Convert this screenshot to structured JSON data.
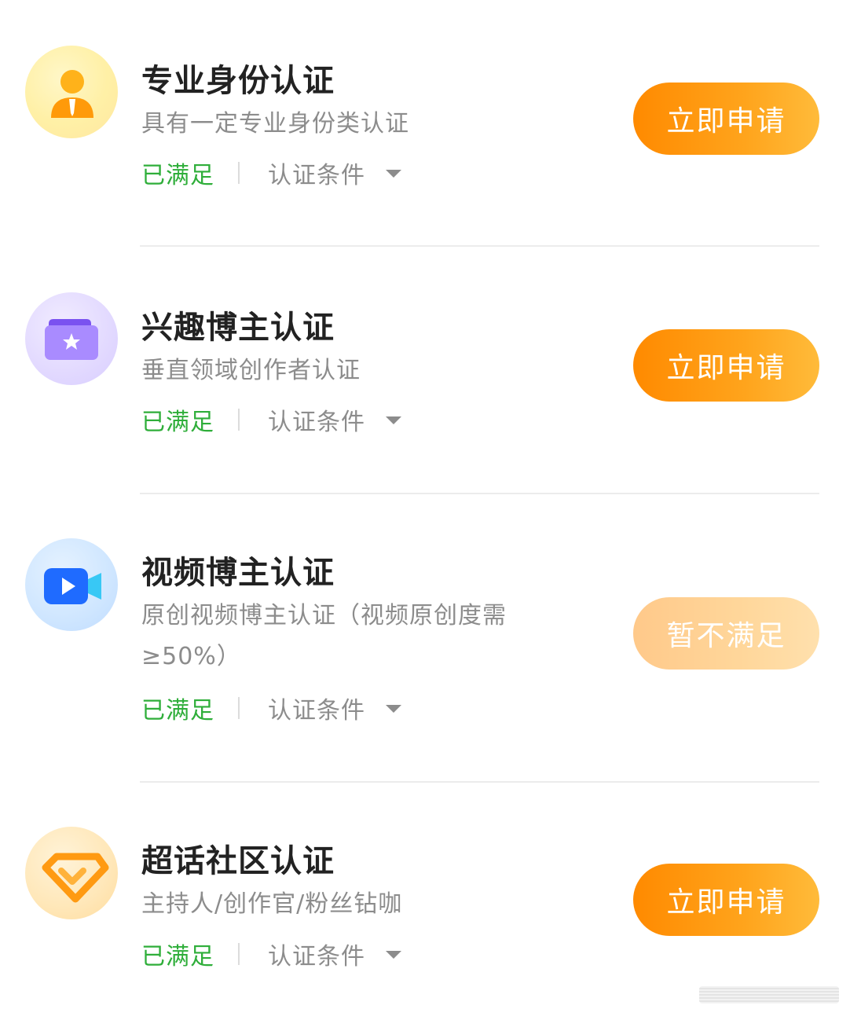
{
  "items": [
    {
      "title": "专业身份认证",
      "desc": "具有一定专业身份类认证",
      "status": "已满足",
      "conditions": "认证条件",
      "button": "立即申请",
      "icon": "person-badge-icon"
    },
    {
      "title": "兴趣博主认证",
      "desc": "垂直领域创作者认证",
      "status": "已满足",
      "conditions": "认证条件",
      "button": "立即申请",
      "icon": "folder-star-icon"
    },
    {
      "title": "视频博主认证",
      "desc": "原创视频博主认证（视频原创度需≥50%）",
      "status": "已满足",
      "conditions": "认证条件",
      "button": "暂不满足",
      "icon": "video-camera-icon"
    },
    {
      "title": "超话社区认证",
      "desc": "主持人/创作官/粉丝钻咖",
      "status": "已满足",
      "conditions": "认证条件",
      "button": "立即申请",
      "icon": "diamond-icon"
    }
  ],
  "colors": {
    "accent": "#ff8a00",
    "success": "#2fae3a",
    "muted": "#8c8c8c",
    "title": "#222222"
  }
}
